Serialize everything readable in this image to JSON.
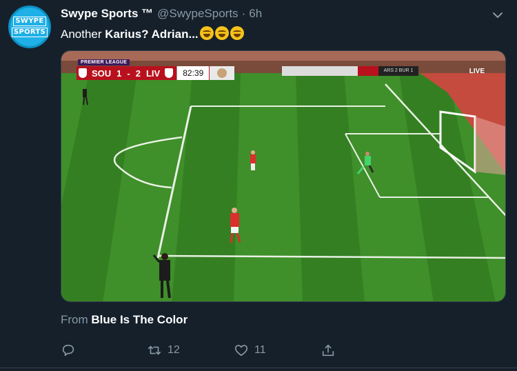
{
  "tweet": {
    "avatar": {
      "word1": "SWYPE",
      "word2": "SPORTS",
      "color": "#1eb0e6"
    },
    "display_name": "Swype Sports ™",
    "handle": "@SwypeSports",
    "separator": "·",
    "time": "6h",
    "text_prefix": "Another ",
    "text_bold": "Karius? Adrian...",
    "emoji_name": "joy-emoji",
    "emoji_count": 3,
    "from_prefix": "From ",
    "from_source": "Blue Is The Color",
    "actions": {
      "reply_icon": "reply-icon",
      "retweet_icon": "retweet-icon",
      "retweet_count": "12",
      "like_icon": "heart-icon",
      "like_count": "11",
      "share_icon": "share-icon"
    }
  },
  "video": {
    "scorebug": {
      "league": "PREMIER LEAGUE",
      "home_team": "SOU",
      "home_score": "1",
      "away_score": "2",
      "away_team": "LIV",
      "score_sep": "-",
      "clock": "82:39"
    },
    "live_label": "LIVE",
    "ticker_text": "ARS 2 BUR 1"
  },
  "colors": {
    "background": "#15202b",
    "secondary_text": "#8899a6",
    "pitch_light": "#3f8f2a",
    "pitch_dark": "#2f7a20",
    "scorebug_red": "#b8111d"
  }
}
